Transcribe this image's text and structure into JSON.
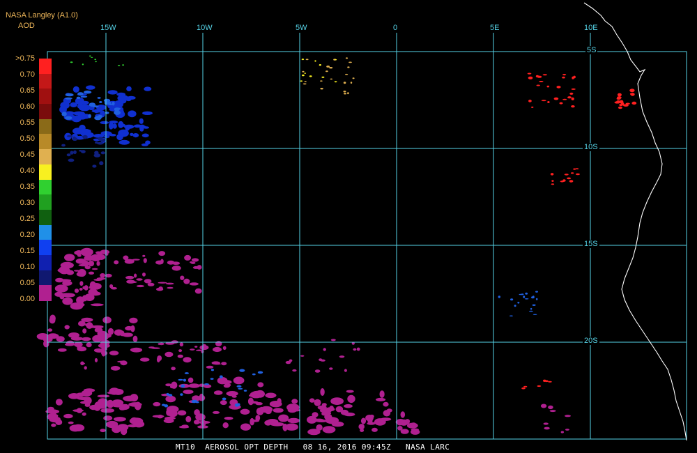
{
  "header": {
    "source": "NASA Langley (A1.0)",
    "units": "AOD"
  },
  "colorbar": {
    "labels": [
      ">0.75",
      "0.70",
      "0.65",
      "0.60",
      "0.55",
      "0.50",
      "0.45",
      "0.40",
      "0.35",
      "0.30",
      "0.25",
      "0.20",
      "0.15",
      "0.10",
      "0.05",
      "0.00"
    ],
    "colors": [
      "#ff2020",
      "#c41818",
      "#a01010",
      "#7a0c0c",
      "#8a6a18",
      "#b88a28",
      "#e0b050",
      "#f8f020",
      "#30d030",
      "#20a020",
      "#106010",
      "#2090e8",
      "#1040f0",
      "#1020b0",
      "#101870",
      "#b02090"
    ]
  },
  "grid": {
    "lon_labels": [
      "15W",
      "10W",
      "5W",
      "0",
      "5E",
      "10E"
    ],
    "lat_labels": [
      "5S",
      "10S",
      "15S",
      "20S"
    ]
  },
  "footer": {
    "text": "MT10  AEROSOL OPT DEPTH   08 16, 2016 09:45Z   NASA LARC"
  },
  "colors": {
    "grid": "#56d4e8",
    "coast": "#ffffff",
    "low_aod": "#b02090"
  }
}
